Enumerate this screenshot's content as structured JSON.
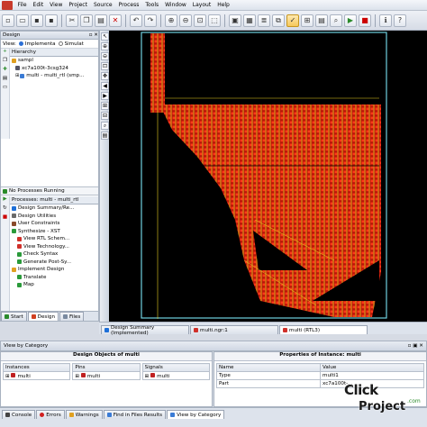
{
  "menu": [
    "File",
    "Edit",
    "View",
    "Project",
    "Source",
    "Process",
    "Tools",
    "Window",
    "Layout",
    "Help"
  ],
  "design": {
    "header": "Design",
    "view_label": "View:",
    "view_options": [
      "Implementa",
      "Simulat"
    ],
    "hierarchy_title": "Hierarchy",
    "hierarchy": [
      "sampl",
      "xc7a100t-3csg324",
      "multi - multi_rtl (smp..."
    ],
    "status": "No Processes Running",
    "processes_title": "Processes: multi - multi_rtl",
    "processes": [
      "Design Summary/Re...",
      "Design Utilities",
      "User Constraints",
      "Synthesize - XST",
      "View RTL Schem...",
      "View Technology...",
      "Check Syntax",
      "Generate Post-Sy...",
      "Implement Design",
      "Translate",
      "Map"
    ],
    "tabs": [
      "Start",
      "Design",
      "Files"
    ]
  },
  "doc_tabs": [
    "Design Summary (Implemented)",
    "multi.ngr:1",
    "multi (RTL3)"
  ],
  "view_by_category": "View by Category",
  "design_objects": {
    "title": "Design Objects of multi",
    "instances": {
      "header": "Instances",
      "items": [
        "multi"
      ]
    },
    "pins": {
      "header": "Pins",
      "items": [
        "multi"
      ]
    },
    "signals": {
      "header": "Signals",
      "items": [
        "multi"
      ]
    }
  },
  "properties": {
    "title": "Properties of Instance: multi",
    "columns": [
      "Name",
      "Value"
    ],
    "rows": [
      [
        "Type",
        "multi1"
      ],
      [
        "Part",
        "xc7a100t-..."
      ]
    ]
  },
  "bottom_tabs": [
    "Console",
    "Errors",
    "Warnings",
    "Find in Files Results",
    "View by Category"
  ],
  "watermark": {
    "line1": "Click",
    "line2": "Project",
    "suffix": ".com"
  },
  "colors": {
    "schematic_bg": "#000000",
    "logic": "#e02010",
    "wire": "#f0e020",
    "border": "#6fd0e0"
  }
}
